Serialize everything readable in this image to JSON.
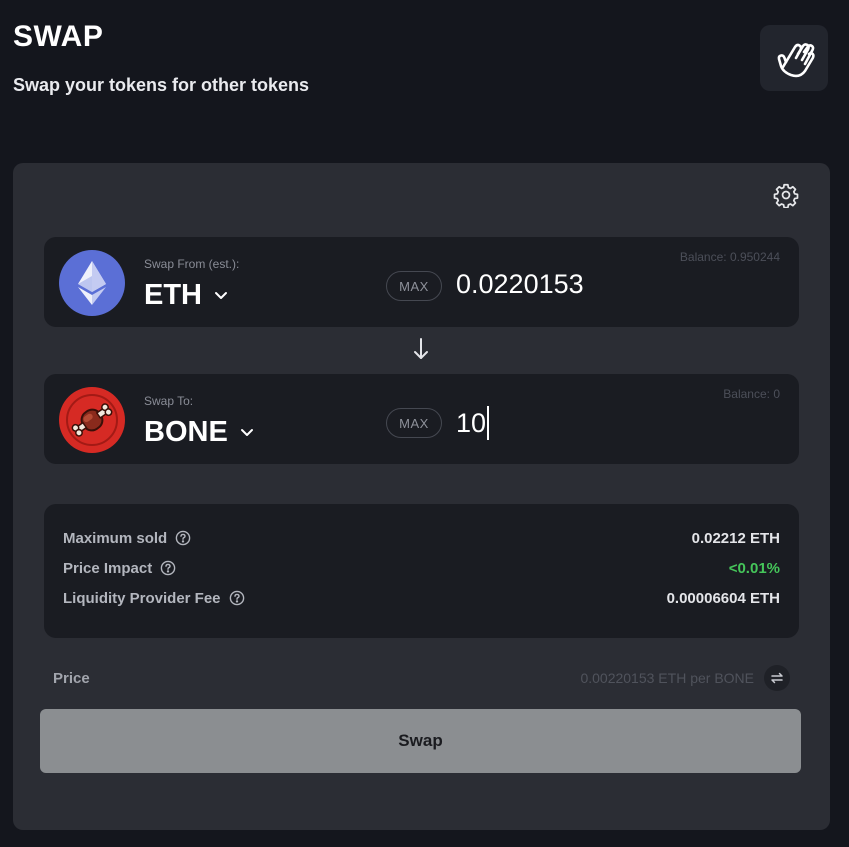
{
  "header": {
    "title": "SWAP",
    "subtitle": "Swap your tokens for other tokens",
    "hand_icon": "hand-pointer-icon"
  },
  "settings": {
    "icon": "gear-icon"
  },
  "swap_from": {
    "label": "Swap From (est.):",
    "symbol": "ETH",
    "logo": "ethereum-logo",
    "max_label": "MAX",
    "amount": "0.0220153",
    "balance": "Balance: 0.950244"
  },
  "swap_to": {
    "label": "Swap To:",
    "symbol": "BONE",
    "logo": "bone-logo",
    "max_label": "MAX",
    "amount": "10",
    "balance": "Balance: 0"
  },
  "details": {
    "rows": [
      {
        "name": "Maximum sold",
        "value": "0.02212 ETH"
      },
      {
        "name": "Price Impact",
        "value": "<0.01%",
        "value_color": "#45c55a"
      },
      {
        "name": "Liquidity Provider Fee",
        "value": "0.00006604 ETH"
      }
    ]
  },
  "price": {
    "label": "Price",
    "value": "0.00220153 ETH per BONE"
  },
  "swap_button": {
    "label": "Swap"
  },
  "colors": {
    "background": "#14161d",
    "card": "#2b2d34",
    "row": "#1a1c22",
    "eth": "#5b6fd6",
    "bone": "#d62a24",
    "positive": "#45c55a",
    "button": "#8b8e91"
  }
}
